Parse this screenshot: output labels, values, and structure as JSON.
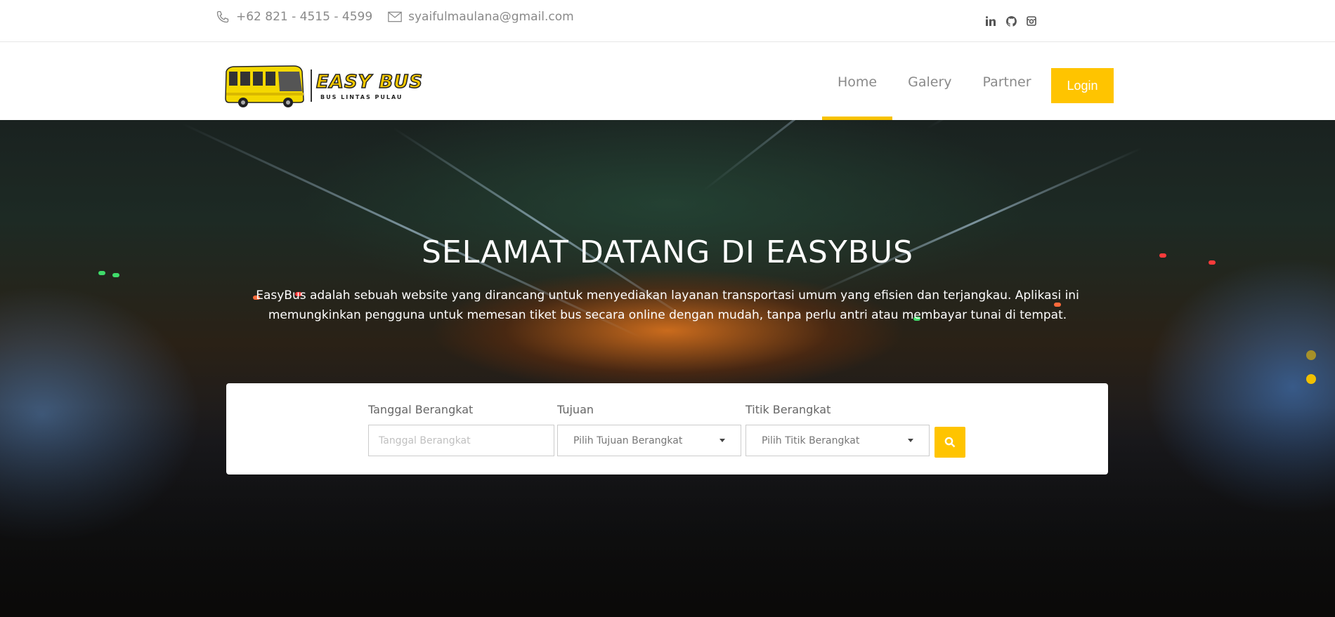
{
  "topbar": {
    "phone": "+62 821 - 4515 - 4599",
    "email": "syaifulmaulana@gmail.com",
    "social": [
      "linkedin-icon",
      "github-icon",
      "instagram-icon"
    ]
  },
  "brand": {
    "name": "EASY BUS",
    "tagline": "BUS LINTAS PULAU"
  },
  "nav": {
    "items": [
      {
        "label": "Home",
        "active": true
      },
      {
        "label": "Galery",
        "active": false
      },
      {
        "label": "Partner",
        "active": false
      }
    ],
    "login_label": "Login"
  },
  "hero": {
    "title": "SELAMAT DATANG DI EASYBUS",
    "description": "EasyBus adalah sebuah website yang dirancang untuk menyediakan layanan transportasi umum yang efisien dan terjangkau. Aplikasi ini memungkinkan pengguna untuk memesan tiket bus secara online dengan mudah, tanpa perlu antri atau membayar tunai di tempat."
  },
  "search": {
    "date": {
      "label": "Tanggal Berangkat",
      "placeholder": "Tanggal Berangkat"
    },
    "destination": {
      "label": "Tujuan",
      "value": "Pilih Tujuan Berangkat"
    },
    "origin": {
      "label": "Titik Berangkat",
      "value": "Pilih Titik Berangkat"
    },
    "button_icon": "search-icon"
  },
  "colors": {
    "accent": "#ffc400"
  }
}
